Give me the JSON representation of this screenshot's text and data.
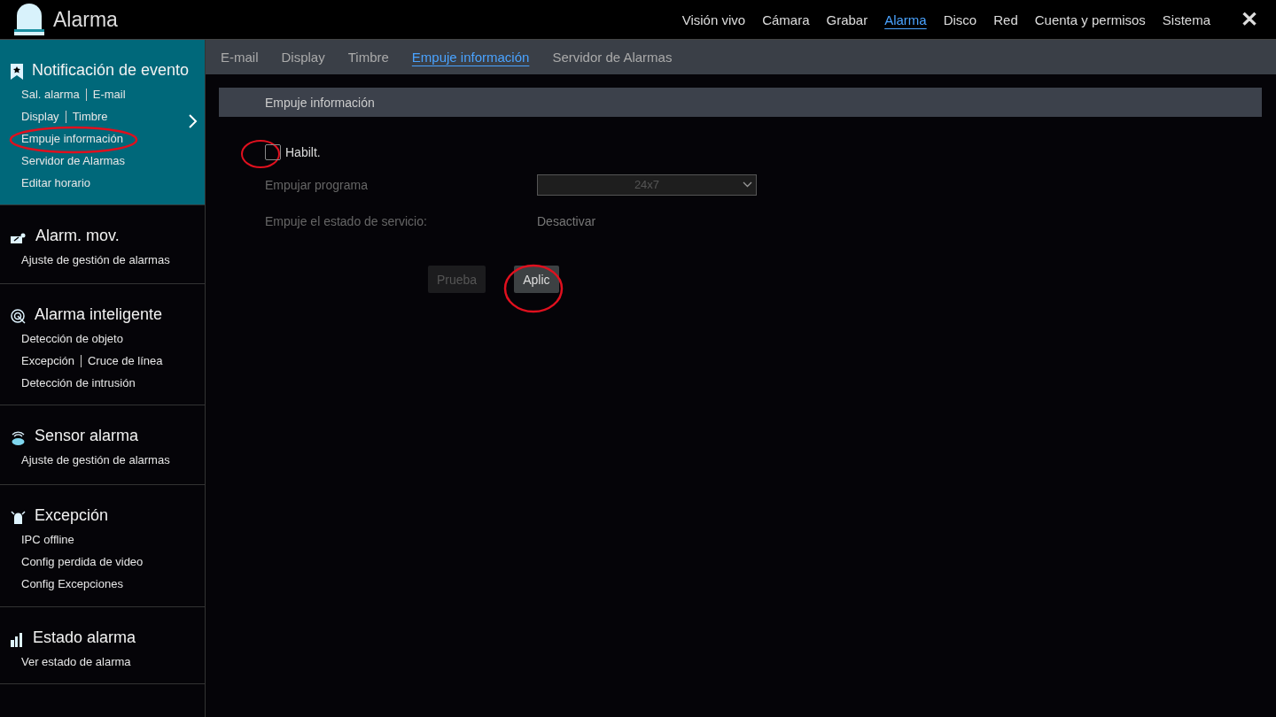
{
  "app": {
    "title": "Alarma"
  },
  "nav": [
    {
      "label": "Visión vivo",
      "selected": false
    },
    {
      "label": "Cámara",
      "selected": false
    },
    {
      "label": "Grabar",
      "selected": false
    },
    {
      "label": "Alarma",
      "selected": true
    },
    {
      "label": "Disco",
      "selected": false
    },
    {
      "label": "Red",
      "selected": false
    },
    {
      "label": "Cuenta y permisos",
      "selected": false
    },
    {
      "label": "Sistema",
      "selected": false
    }
  ],
  "close": "✕",
  "sidebar": [
    {
      "kind": "bell",
      "title": "Notificación de evento",
      "selected": true,
      "lines": [
        [
          "Sal. alarma",
          "E-mail"
        ],
        [
          "Display",
          "Timbre"
        ],
        [
          "Empuje información"
        ],
        [
          "Servidor de Alarmas"
        ],
        [
          "Editar horario"
        ]
      ]
    },
    {
      "kind": "motion",
      "title": "Alarm. mov.",
      "selected": false,
      "lines": [
        [
          "Ajuste de gestión de alarmas"
        ]
      ]
    },
    {
      "kind": "target",
      "title": "Alarma inteligente",
      "selected": false,
      "lines": [
        [
          "Detección de objeto"
        ],
        [
          "Excepción",
          "Cruce de línea"
        ],
        [
          "Detección de intrusión"
        ]
      ]
    },
    {
      "kind": "sensor",
      "title": "Sensor alarma",
      "selected": false,
      "lines": [
        [
          "Ajuste de gestión de alarmas"
        ]
      ]
    },
    {
      "kind": "siren",
      "title": "Excepción",
      "selected": false,
      "lines": [
        [
          "IPC offline"
        ],
        [
          "Config perdida de video"
        ],
        [
          "Config Excepciones"
        ]
      ]
    },
    {
      "kind": "chart",
      "title": "Estado alarma",
      "selected": false,
      "lines": [
        [
          "Ver estado de alarma"
        ]
      ]
    }
  ],
  "subtabs": [
    {
      "label": "E-mail",
      "selected": false
    },
    {
      "label": "Display",
      "selected": false
    },
    {
      "label": "Timbre",
      "selected": false
    },
    {
      "label": "Empuje información",
      "selected": true
    },
    {
      "label": "Servidor de Alarmas",
      "selected": false
    }
  ],
  "section": {
    "title": "Empuje información"
  },
  "form": {
    "enable": {
      "label": "Habilt.",
      "checked": false
    },
    "schedule": {
      "label": "Empujar programa",
      "value": "24x7",
      "disabled": true
    },
    "status": {
      "label": "Empuje el estado de servicio:",
      "value": "Desactivar"
    }
  },
  "buttons": [
    {
      "label": "Prueba",
      "disabled": true
    },
    {
      "label": "Aplic",
      "disabled": false
    }
  ]
}
